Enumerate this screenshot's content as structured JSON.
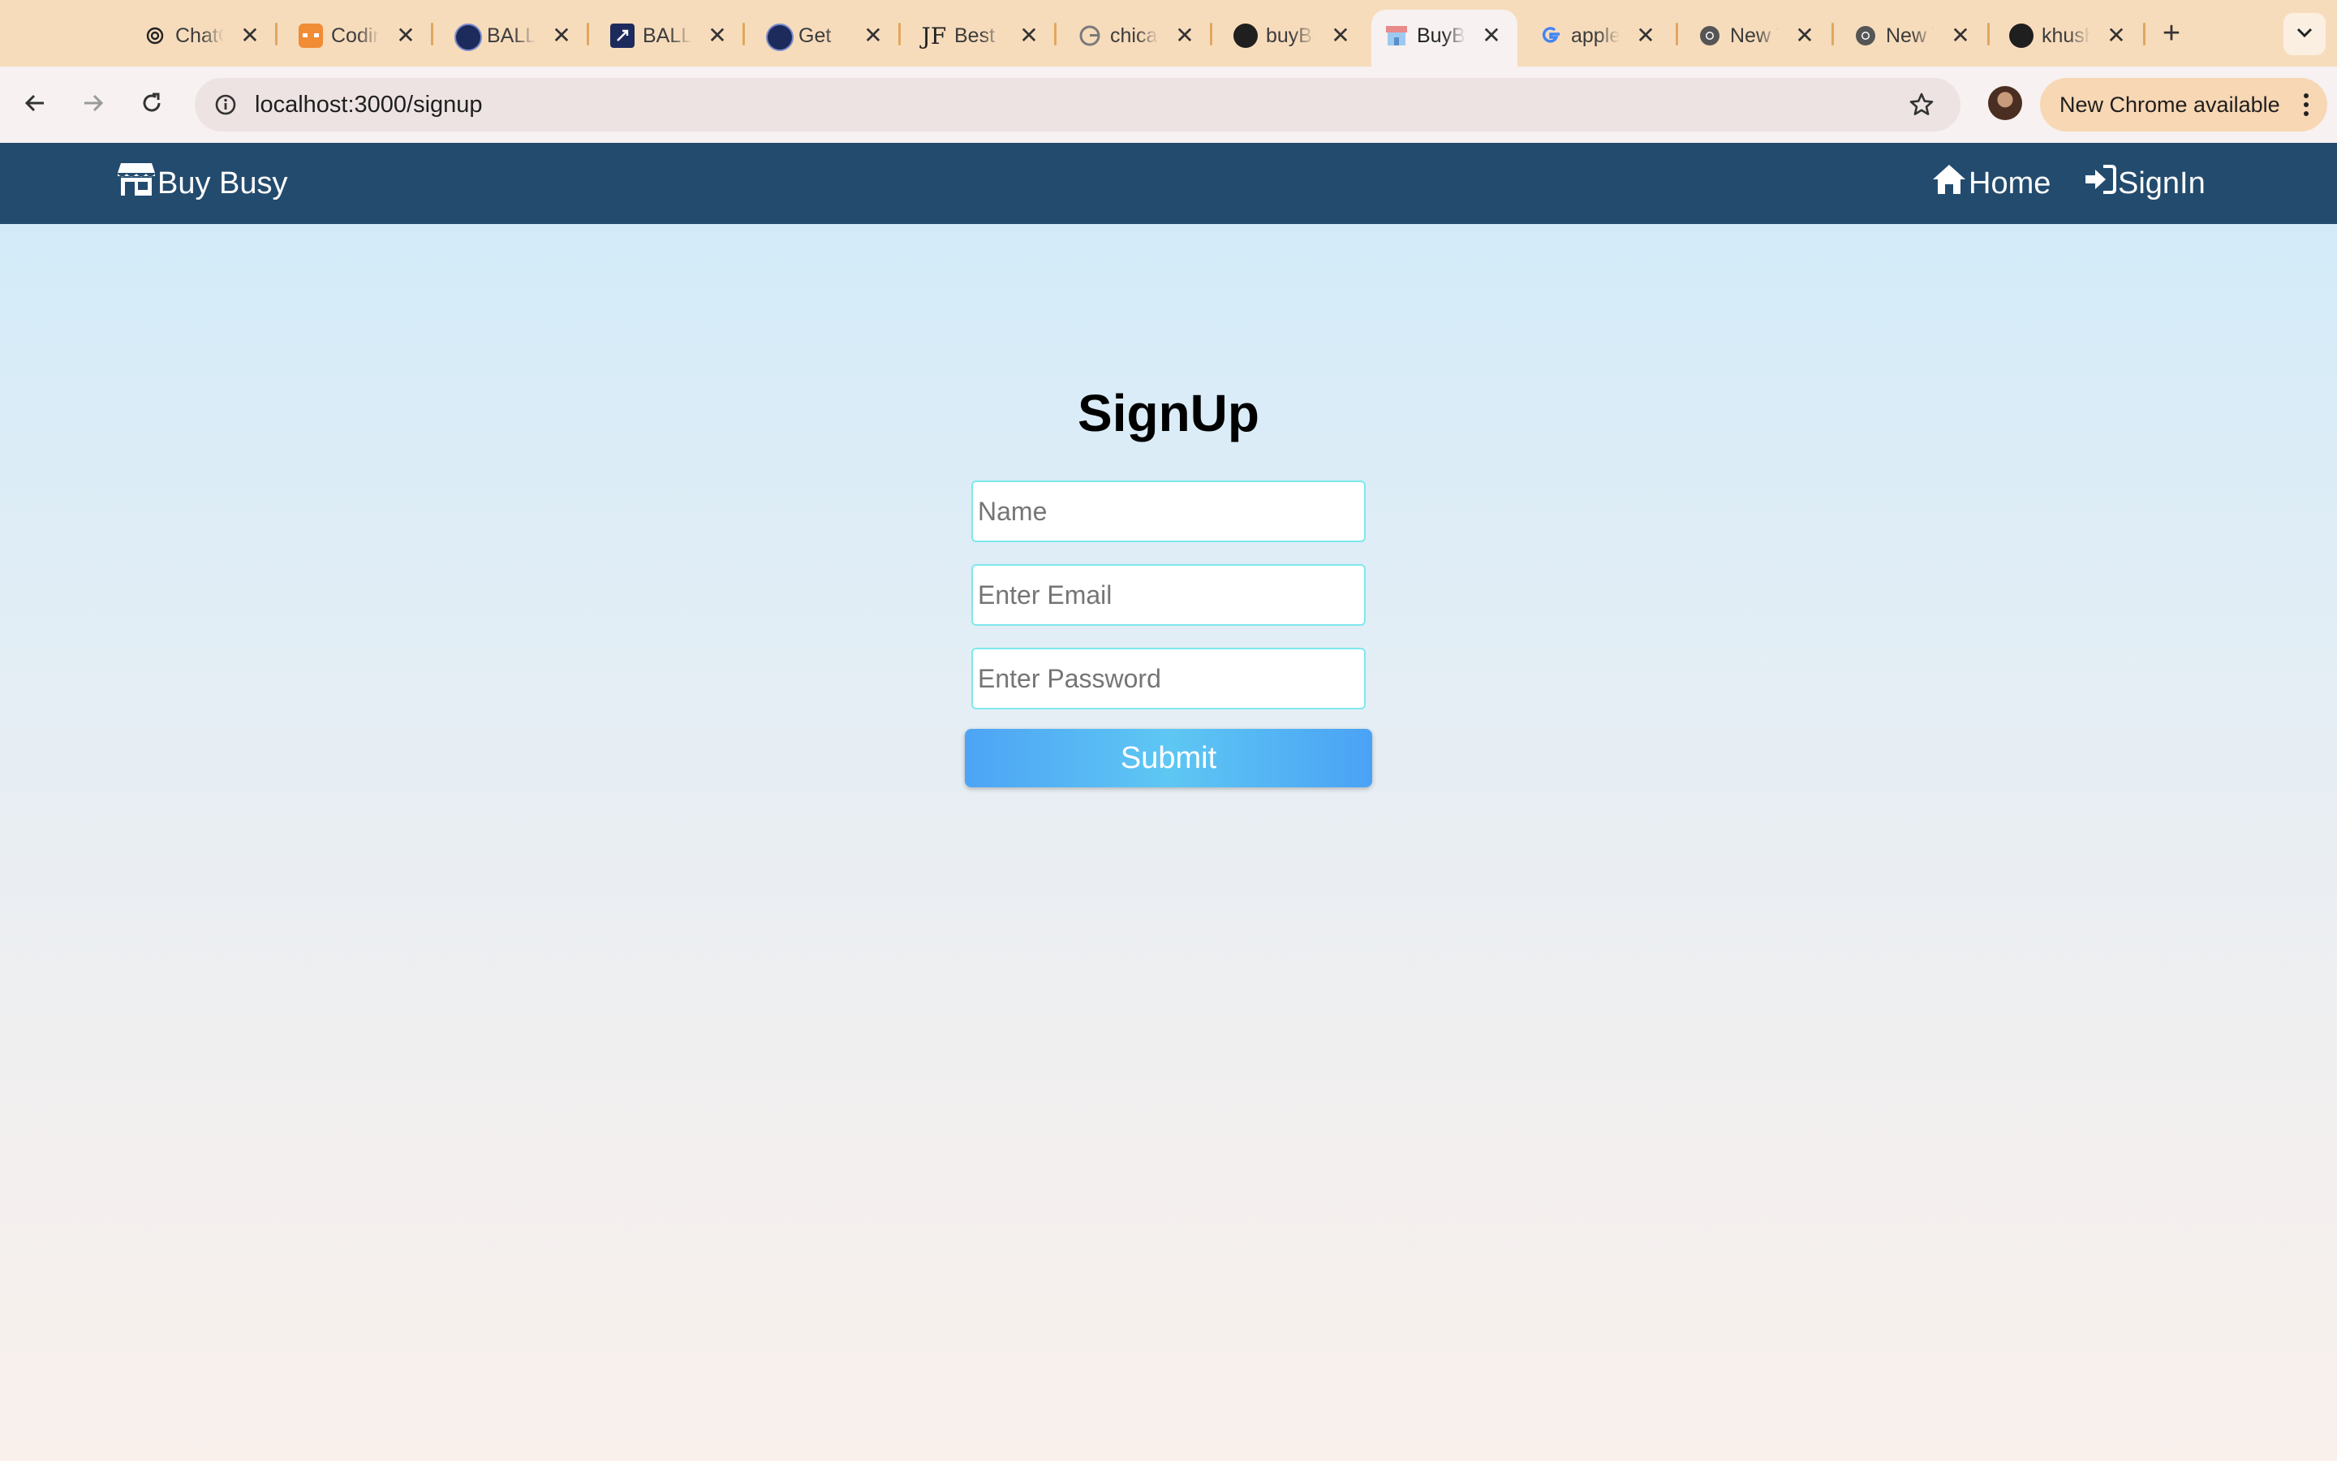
{
  "browser": {
    "tabs": [
      {
        "title": "ChatGPT",
        "icon": "openai-icon"
      },
      {
        "title": "Coding Ninjas",
        "icon": "coding-ninjas-icon"
      },
      {
        "title": "BALLOT",
        "icon": "ballot-icon"
      },
      {
        "title": "BALLOT",
        "icon": "rocket-icon"
      },
      {
        "title": "Get",
        "icon": "ballot-icon"
      },
      {
        "title": "Best",
        "icon": "jf-icon"
      },
      {
        "title": "chicago",
        "icon": "google-icon"
      },
      {
        "title": "buyBusy",
        "icon": "github-icon"
      },
      {
        "title": "BuyBusy",
        "icon": "store-icon",
        "active": true
      },
      {
        "title": "apple",
        "icon": "google-icon"
      },
      {
        "title": "New Tab",
        "icon": "chrome-icon"
      },
      {
        "title": "New Tab",
        "icon": "chrome-icon"
      },
      {
        "title": "khushi",
        "icon": "github-icon"
      }
    ],
    "favicon_jf": "JF",
    "url": "localhost:3000/signup",
    "update_label": "New Chrome available",
    "colors": {
      "tabstrip": "#f7dcbc",
      "toolbar": "#f7f1f1",
      "separator": "#e0a75e"
    }
  },
  "navbar": {
    "brand": "Buy Busy",
    "links": [
      {
        "label": "Home",
        "icon": "home-icon"
      },
      {
        "label": "SignIn",
        "icon": "sign-in-icon"
      }
    ],
    "color": "#234b6e"
  },
  "signup": {
    "title": "SignUp",
    "name_placeholder": "Name",
    "email_placeholder": "Enter Email",
    "password_placeholder": "Enter Password",
    "submit_label": "Submit"
  }
}
